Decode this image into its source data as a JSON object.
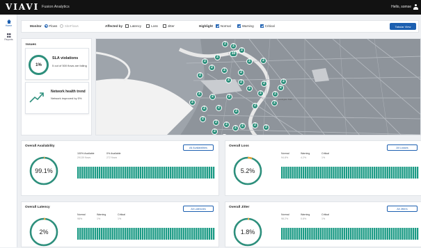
{
  "app": {
    "brand": "VIAVI",
    "name": "Fusion Analytics",
    "greeting": "Hello, somse"
  },
  "nav": {
    "items": [
      {
        "label": "Home"
      },
      {
        "label": "Reports"
      }
    ]
  },
  "filters": {
    "monitor_label": "Monitor",
    "monitor_options": [
      "Flows",
      "SiteFlows"
    ],
    "affected_label": "Affected by",
    "affected_options": [
      "Latency",
      "Loss",
      "Jitter"
    ],
    "highlight_label": "Highlight",
    "highlight_options": [
      "Normal",
      "Warning",
      "Critical"
    ],
    "tabular_button": "Tabular View"
  },
  "issues": {
    "title": "Issues",
    "sla": {
      "value": "1%",
      "title": "SLA violations",
      "subtitle": "5 out of 500 flows are failing"
    },
    "trend": {
      "title": "Network health trend",
      "subtitle": "Network improved by 5%"
    }
  },
  "map": {
    "area_label": "Lexington Park",
    "marker_value": "2",
    "counts": [
      "2",
      "2",
      "2",
      "10",
      "2",
      "2",
      "2",
      "2",
      "2",
      "2",
      "2",
      "2",
      "2",
      "2",
      "2",
      "2",
      "2",
      "2",
      "2",
      "2",
      "2",
      "2",
      "2",
      "2",
      "2",
      "2",
      "2",
      "2",
      "2",
      "2",
      "2",
      "2",
      "2",
      "2",
      "2",
      "2",
      "2",
      "2"
    ]
  },
  "panels": {
    "availability": {
      "title": "Overall Availability",
      "value": "99.1%",
      "button": "All Availabilities",
      "fraction": 0.991,
      "legend": [
        {
          "label": "100% Available",
          "value": "29139 flows"
        },
        {
          "label": "0% Available",
          "value": "272 flows"
        }
      ]
    },
    "loss": {
      "title": "Overall Loss",
      "value": "5.2%",
      "button": "All Losses",
      "fraction": 0.052,
      "legend": [
        {
          "label": "Normal",
          "value": "94.8%"
        },
        {
          "label": "Warning",
          "value": "4.2%"
        },
        {
          "label": "Critical",
          "value": "1%"
        }
      ]
    },
    "latency": {
      "title": "Overall Latency",
      "value": "2%",
      "button": "All Latencies",
      "fraction": 0.02,
      "legend": [
        {
          "label": "Normal",
          "value": "98%"
        },
        {
          "label": "Warning",
          "value": "1%"
        },
        {
          "label": "Critical",
          "value": "1%"
        }
      ]
    },
    "jitter": {
      "title": "Overall Jitter",
      "value": "1.8%",
      "button": "All Jitters",
      "fraction": 0.018,
      "legend": [
        {
          "label": "Normal",
          "value": "98.2%"
        },
        {
          "label": "Warning",
          "value": "0.8%"
        },
        {
          "label": "Critical",
          "value": "1%"
        }
      ]
    }
  },
  "colors": {
    "accent": "#1c5fb0",
    "normal": "#2d8f7c",
    "bar": "#1a9a84",
    "warning": "#e8a53c"
  }
}
